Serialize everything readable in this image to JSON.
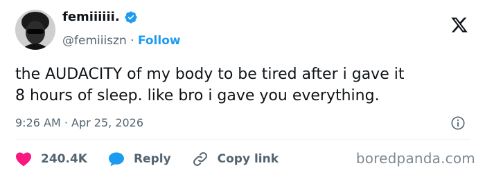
{
  "author": {
    "display_name": "femiiiiii.",
    "handle": "@femiiiszn",
    "separator": "·",
    "follow_label": "Follow"
  },
  "tweet": {
    "lines": [
      "the AUDACITY of my body to be tired after i gave it",
      "8 hours of sleep. like bro i gave you everything."
    ],
    "timestamp": "9:26 AM · Apr 25, 2026"
  },
  "actions": {
    "likes": "240.4K",
    "reply_label": "Reply",
    "copy_link_label": "Copy link"
  },
  "watermark": "boredpanda.com",
  "colors": {
    "accent": "#1d9bf0",
    "like": "#f91880",
    "muted_text": "#536471",
    "text": "#0f1419"
  },
  "icons": [
    "verified-badge-icon",
    "x-logo-icon",
    "info-icon",
    "heart-icon",
    "reply-bubble-icon",
    "link-icon"
  ]
}
